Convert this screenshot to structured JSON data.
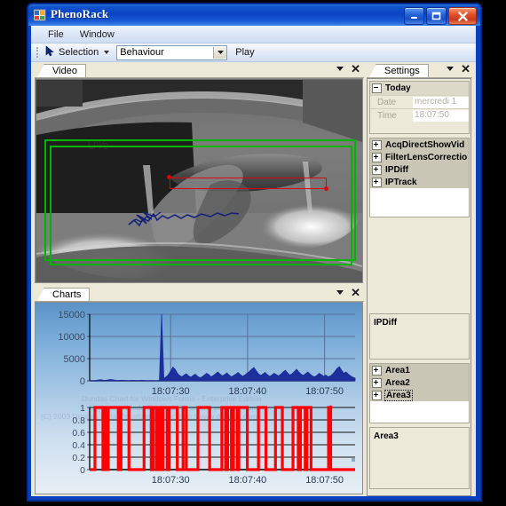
{
  "window": {
    "title": "PhenoRack",
    "icon": "app-icon",
    "buttons": {
      "minimize": "_",
      "maximize": "□",
      "close": "✕"
    }
  },
  "menubar": {
    "items": [
      {
        "label": "File"
      },
      {
        "label": "Window"
      }
    ]
  },
  "toolbar": {
    "selection_label": "Selection",
    "selection_icon": "cursor-arrow-icon",
    "combo_value": "Behaviour",
    "combo_options": [
      "Behaviour"
    ],
    "play_label": "Play"
  },
  "video_panel": {
    "tab_label": "Video",
    "menu_icon": "chevron-down-icon",
    "close_icon": "close-icon",
    "overlays": {
      "green_rect_outer": "detection-zone-outer",
      "green_rect_inner": "detection-zone-inner",
      "red_rect": "measurement-zone",
      "blue_track": "animal-track"
    }
  },
  "charts_panel": {
    "tab_label": "Charts",
    "menu_icon": "chevron-down-icon",
    "close_icon": "close-icon",
    "watermark": [
      "Dundas Chart for Windows Forms - Enterprise Edition",
      "Evaluation Mode Enabled, for testing purposes only",
      "(C) 2003 Dundas Data Visualization, Inc.  http://www.dundas.com"
    ]
  },
  "settings_panel": {
    "tab_label": "Settings",
    "menu_icon": "chevron-down-icon",
    "close_icon": "close-icon",
    "today": {
      "title": "Today",
      "expander": "collapse-icon",
      "rows": [
        {
          "key": "Date",
          "value": "mercredi 1"
        },
        {
          "key": "Time",
          "value": "18:07:50"
        }
      ]
    },
    "modules": [
      {
        "label": "AcqDirectShowVid",
        "expander": "expand-icon"
      },
      {
        "label": "FilterLensCorrectio",
        "expander": "expand-icon"
      },
      {
        "label": "IPDiff",
        "expander": "expand-icon"
      },
      {
        "label": "IPTrack",
        "expander": "expand-icon"
      }
    ],
    "module_description": "IPDiff",
    "areas": [
      {
        "label": "Area1",
        "expander": "expand-icon",
        "selected": false
      },
      {
        "label": "Area2",
        "expander": "expand-icon",
        "selected": false
      },
      {
        "label": "Area3",
        "expander": "expand-icon",
        "selected": true
      }
    ],
    "area_description": "Area3"
  },
  "chart_data": [
    {
      "type": "area",
      "title": "",
      "xlabel": "",
      "ylabel": "",
      "ylim": [
        0,
        15000
      ],
      "yticks": [
        0,
        5000,
        10000,
        15000
      ],
      "ytick_labels": [
        "0",
        "5000",
        "10000",
        "15000"
      ],
      "xticks": [
        "18:07:30",
        "18:07:40",
        "18:07:50"
      ],
      "grid": true,
      "series_color": "#1c2f9c",
      "x": [
        0,
        1,
        2,
        3,
        4,
        5,
        6,
        7,
        8,
        9,
        10,
        11,
        12,
        13,
        14,
        15,
        16,
        17,
        18,
        19,
        20,
        21,
        22,
        23,
        24,
        25,
        26,
        27,
        28,
        29,
        30,
        31,
        32,
        33,
        34,
        35,
        36,
        37,
        38,
        39,
        40,
        41,
        42,
        43,
        44,
        45,
        46,
        47,
        48,
        49,
        50,
        51,
        52,
        53,
        54,
        55,
        56,
        57,
        58,
        59,
        60,
        61,
        62,
        63,
        64,
        65,
        66,
        67,
        68,
        69,
        70,
        71,
        72,
        73,
        74,
        75,
        76,
        77,
        78,
        79,
        80,
        81,
        82,
        83,
        84,
        85,
        86,
        87,
        88,
        89,
        90,
        91,
        92,
        93,
        94,
        95,
        96,
        97,
        98,
        99,
        100,
        101,
        102,
        103,
        104,
        105,
        106,
        107,
        108,
        109,
        110,
        111,
        112,
        113,
        114,
        115,
        116,
        117,
        118,
        119
      ],
      "values": [
        60,
        80,
        50,
        120,
        200,
        260,
        150,
        110,
        200,
        300,
        260,
        180,
        120,
        90,
        140,
        110,
        70,
        60,
        80,
        120,
        90,
        60,
        70,
        110,
        90,
        60,
        50,
        80,
        60,
        50,
        40,
        60,
        15000,
        500,
        900,
        1400,
        2200,
        3100,
        2600,
        1700,
        1200,
        900,
        1300,
        1600,
        1100,
        800,
        1200,
        1500,
        1000,
        700,
        900,
        1300,
        1700,
        1400,
        900,
        1200,
        1600,
        2000,
        1500,
        1100,
        1400,
        1800,
        1300,
        900,
        1200,
        1500,
        1900,
        1400,
        1000,
        1300,
        1700,
        2100,
        2600,
        3000,
        2300,
        1600,
        1200,
        1500,
        1900,
        1400,
        1000,
        1300,
        1700,
        1400,
        1100,
        1500,
        2000,
        2400,
        1800,
        1300,
        1600,
        2100,
        2600,
        2000,
        1500,
        1200,
        1600,
        2000,
        1500,
        1100,
        900,
        1200,
        1700,
        1400,
        1000,
        1300,
        900,
        1100,
        1500,
        2100,
        2800,
        3200,
        2400,
        1700,
        2000,
        1500,
        1100,
        800,
        600
      ]
    },
    {
      "type": "line",
      "title": "",
      "xlabel": "",
      "ylabel": "",
      "ylim": [
        0,
        1
      ],
      "yticks": [
        0,
        0.2,
        0.4,
        0.6,
        0.8,
        1
      ],
      "ytick_labels": [
        "0",
        "0.2",
        "0.4",
        "0.6",
        "0.8",
        "1"
      ],
      "xticks": [
        "18:07:30",
        "18:07:40",
        "18:07:50"
      ],
      "grid": true,
      "series_color": "#ff0000",
      "pulses": [
        [
          0.02,
          0.05
        ],
        [
          0.056,
          0.064
        ],
        [
          0.07,
          0.108
        ],
        [
          0.118,
          0.148
        ],
        [
          0.205,
          0.232
        ],
        [
          0.24,
          0.252
        ],
        [
          0.258,
          0.268
        ],
        [
          0.276,
          0.292
        ],
        [
          0.3,
          0.33
        ],
        [
          0.352,
          0.364
        ],
        [
          0.408,
          0.452
        ],
        [
          0.498,
          0.512
        ],
        [
          0.52,
          0.534
        ],
        [
          0.542,
          0.556
        ],
        [
          0.562,
          0.594
        ],
        [
          0.636,
          0.664
        ],
        [
          0.7,
          0.726
        ],
        [
          0.766,
          0.786
        ],
        [
          0.794,
          0.812
        ],
        [
          0.818,
          0.834
        ],
        [
          0.9,
          0.908
        ]
      ]
    }
  ]
}
